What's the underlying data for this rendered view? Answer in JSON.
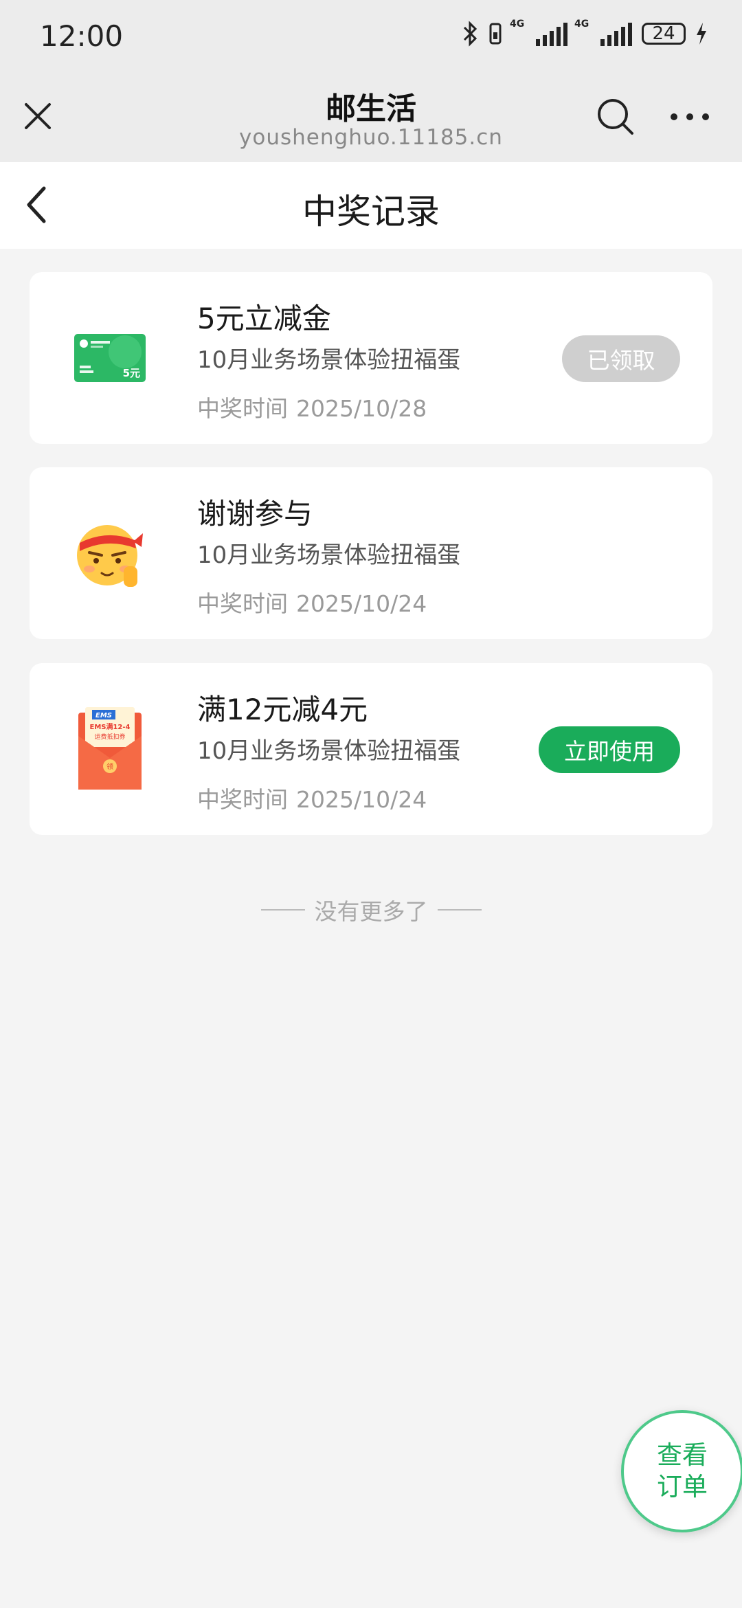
{
  "status_bar": {
    "time": "12:00",
    "network_1": "4G",
    "network_2": "4G",
    "battery": "24"
  },
  "browser": {
    "title": "邮生活",
    "url": "youshenghuo.11185.cn"
  },
  "page": {
    "title": "中奖记录"
  },
  "records": [
    {
      "title": "5元立减金",
      "subtitle": "10月业务场景体验扭福蛋",
      "time_label": "中奖时间",
      "time": "2025/10/28",
      "action": "已领取",
      "image": "voucher-card-icon",
      "image_text": "5元"
    },
    {
      "title": "谢谢参与",
      "subtitle": "10月业务场景体验扭福蛋",
      "time_label": "中奖时间",
      "time": "2025/10/24",
      "image": "cheer-emoji-icon"
    },
    {
      "title": "满12元减4元",
      "subtitle": "10月业务场景体验扭福蛋",
      "time_label": "中奖时间",
      "time": "2025/10/24",
      "action": "立即使用",
      "image": "ems-red-envelope-icon",
      "image_brand": "EMS",
      "image_text": "EMS满12-4",
      "image_sub": "运费抵扣券",
      "image_seal": "领"
    }
  ],
  "end_note": "没有更多了",
  "float_button": {
    "line1": "查看",
    "line2": "订单"
  },
  "colors": {
    "accent": "#1aac5a",
    "claimed": "#cfcfcf",
    "background": "#f4f4f4"
  }
}
